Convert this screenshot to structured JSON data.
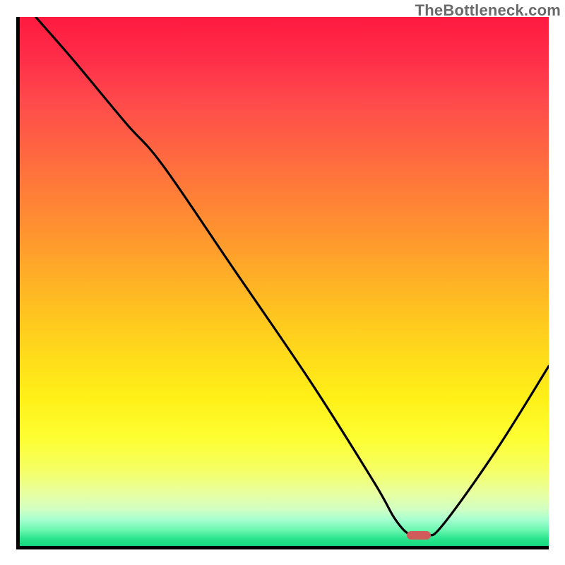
{
  "watermark": "TheBottleneck.com",
  "chart_data": {
    "type": "line",
    "title": "",
    "xlabel": "",
    "ylabel": "",
    "xlim": [
      0,
      100
    ],
    "ylim": [
      0,
      100
    ],
    "grid": false,
    "legend": false,
    "annotations": [],
    "series": [
      {
        "name": "curve",
        "color": "#000000",
        "x": [
          3,
          10,
          20,
          27,
          40,
          55,
          67,
          71,
          74,
          77,
          80,
          90,
          100
        ],
        "y": [
          100,
          92,
          80,
          72,
          53,
          31,
          12,
          5,
          2,
          2,
          4,
          18,
          34
        ]
      }
    ],
    "marker": {
      "name": "optimal-point",
      "x": 75.5,
      "y": 2,
      "color": "#d15a5a"
    },
    "background_gradient": {
      "top": "#ff1a3f",
      "mid": "#ffdb1a",
      "bottom": "#12d87d"
    }
  }
}
